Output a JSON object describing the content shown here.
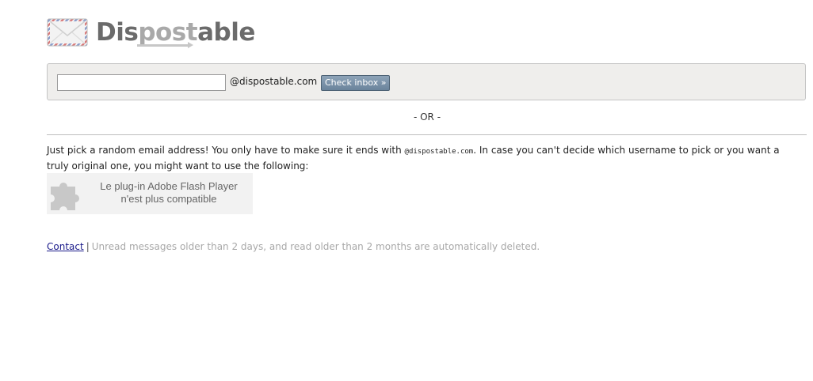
{
  "logo": {
    "text_part1": "Dis",
    "text_part2": "post",
    "text_part3": "able",
    "icon": "envelope-icon"
  },
  "form": {
    "input_value": "",
    "input_placeholder": "",
    "domain": "@dispostable.com",
    "button_label": "Check inbox »"
  },
  "or_text": "- OR -",
  "info": {
    "text_before": "Just pick a random email address! You only have to make sure it ends with ",
    "code": "@dispostable.com",
    "text_after": ". In case you can't decide which username to pick or you want a truly original one, you might want to use the following:"
  },
  "flash": {
    "icon": "puzzle-piece-icon",
    "line1": "Le plug-in Adobe Flash Player",
    "line2": "n'est plus compatible"
  },
  "footer": {
    "contact_label": "Contact",
    "separator": "|",
    "notice": "Unread messages older than 2 days, and read older than 2 months are automatically deleted."
  },
  "colors": {
    "button_bg": "#7891a9",
    "form_bg": "#efeeec",
    "link": "#1a1a8a",
    "muted": "#a8a8a8"
  }
}
